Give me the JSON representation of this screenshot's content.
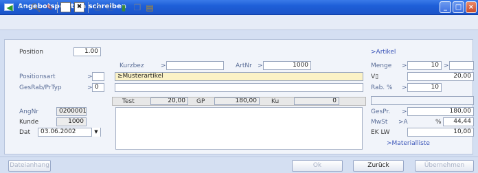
{
  "window": {
    "title": "Angebotsposition schreiben"
  },
  "toolbar": {
    "icons": [
      "arrow-left-icon",
      "refresh-icon",
      "search-icon",
      "pen-icon",
      "new-icon",
      "delete-icon",
      "print-icon",
      "print-preview-icon",
      "database-icon",
      "copy-icon",
      "paste-icon"
    ]
  },
  "form": {
    "position_label": "Position",
    "position_value": "1.00",
    "positionsart_label": "Positionsart",
    "positionsart_arrow": ">",
    "gesrab_label": "GesRab/PrTyp",
    "gesrab_arrow": ">",
    "gesrab_value": "0",
    "angnr_label": "AngNr",
    "angnr_value": "0200001",
    "kunde_label": "Kunde",
    "kunde_value": "1000",
    "dat_label": "Dat",
    "dat_value": "03.06.2002",
    "kurzbez_label": "Kurzbez",
    "kurzbez_arrow": ">",
    "artnr_label": "ArtNr",
    "artnr_arrow": ">",
    "artnr_value": "1000",
    "description_prefix": "≥",
    "description_value": "Musterartikel",
    "test_label": "Test",
    "test_value": "20,00",
    "gp_label": "GP",
    "gp_value": "180,00",
    "ku_label": "Ku",
    "ku_value": "0"
  },
  "right": {
    "artikel_link": ">Artikel",
    "menge_label": "Menge",
    "menge_arrow": ">",
    "menge_value": "10",
    "menge_unit_arrow": ">",
    "vp_label": "V▯",
    "vp_value": "20,00",
    "rab_label": "Rab. %",
    "rab_arrow": ">",
    "rab_value": "10",
    "gespr_label": "GesPr.",
    "gespr_arrow": ">",
    "gespr_value": "180,00",
    "mwst_label": "MwSt",
    "mwst_arrow": ">A",
    "mwst_pct": "%",
    "mwst_value": "44,44",
    "ek_label": "EK  LW",
    "ek_value": "10,00",
    "materialliste_link": ">Materialliste"
  },
  "buttons": {
    "dateianhang": "Dateianhang",
    "ok": "Ok",
    "zurueck": "Zurück",
    "uebernehmen": "Übernehmen"
  }
}
